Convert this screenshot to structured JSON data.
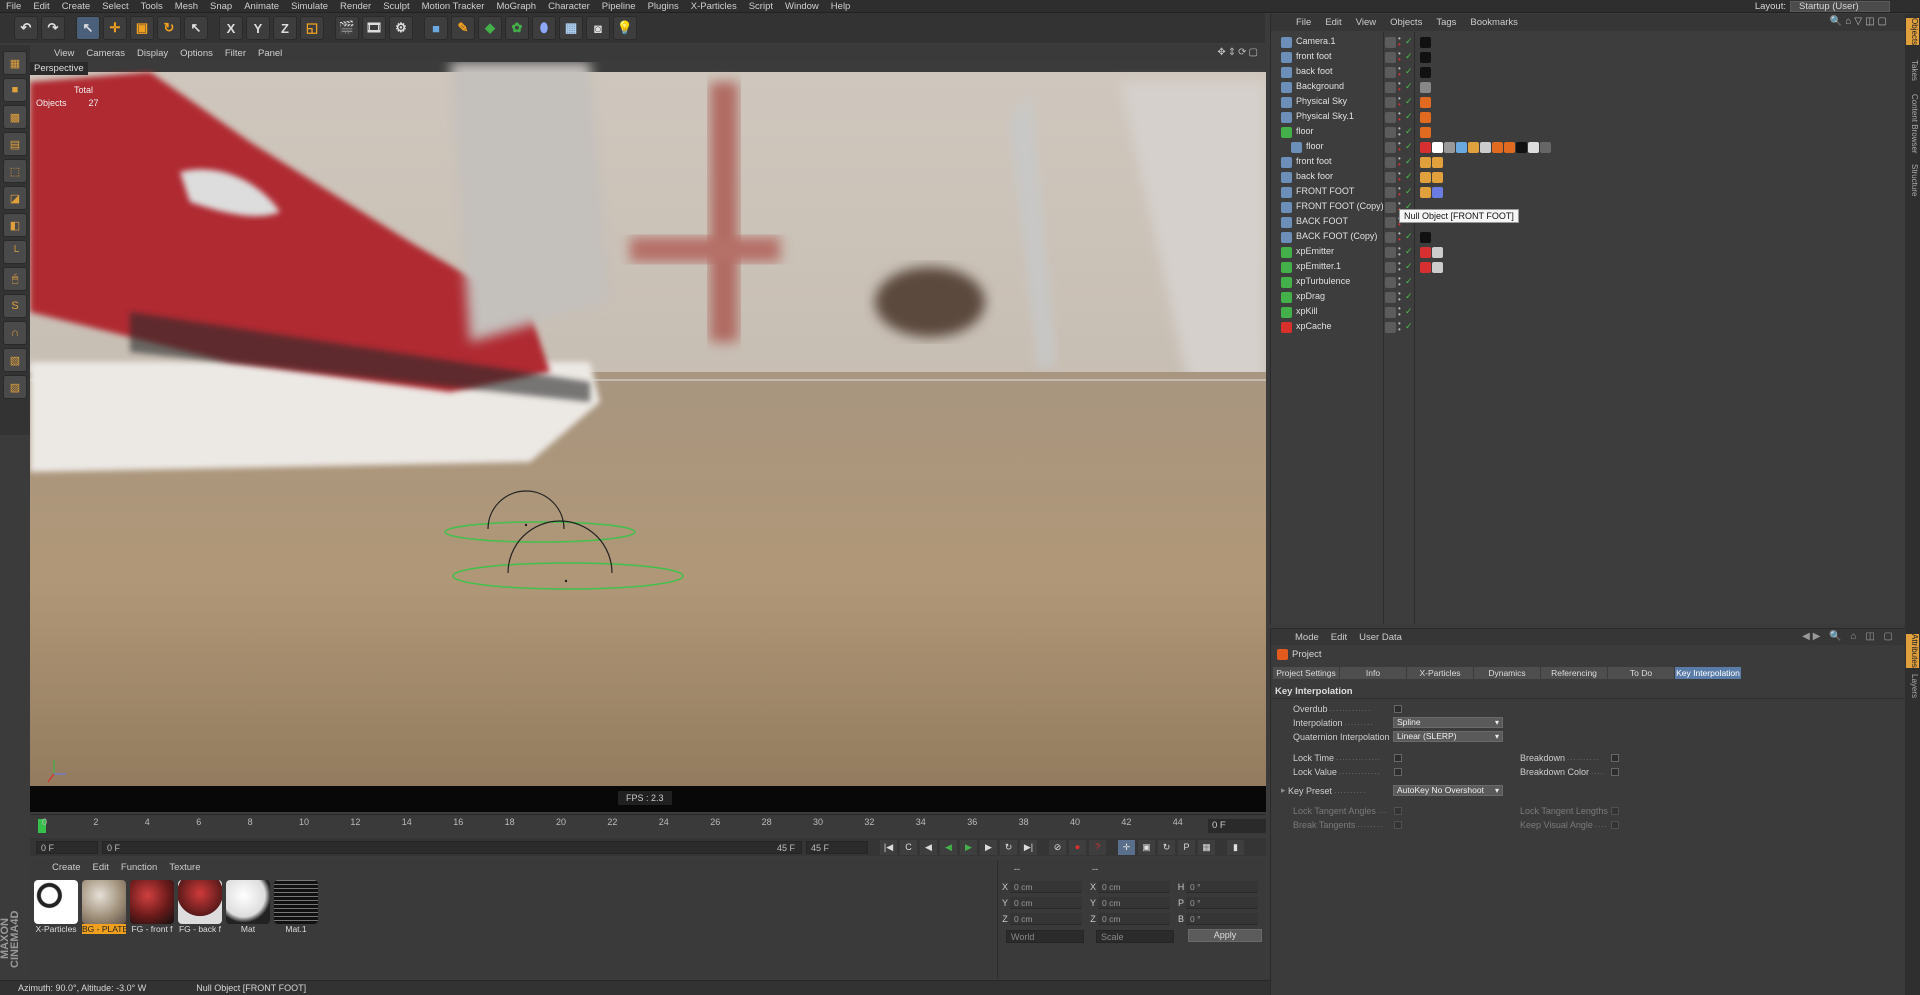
{
  "menubar": {
    "items": [
      "File",
      "Edit",
      "Create",
      "Select",
      "Tools",
      "Mesh",
      "Snap",
      "Animate",
      "Simulate",
      "Render",
      "Sculpt",
      "Motion Tracker",
      "MoGraph",
      "Character",
      "Pipeline",
      "Plugins",
      "X-Particles",
      "Script",
      "Window",
      "Help"
    ],
    "layout_label": "Layout:",
    "layout_value": "Startup (User)"
  },
  "toolbar": {
    "axis_x": "X",
    "axis_y": "Y",
    "axis_z": "Z"
  },
  "viewport": {
    "menu": [
      "View",
      "Cameras",
      "Display",
      "Options",
      "Filter",
      "Panel"
    ],
    "label": "Perspective",
    "hud_total": "Total",
    "hud_objects_label": "Objects",
    "hud_objects_value": "27",
    "fps": "FPS : 2.3"
  },
  "timeline": {
    "ticks": [
      "0",
      "2",
      "4",
      "6",
      "8",
      "10",
      "12",
      "14",
      "16",
      "18",
      "20",
      "22",
      "24",
      "26",
      "28",
      "30",
      "32",
      "34",
      "36",
      "38",
      "40",
      "42",
      "44"
    ],
    "current_frame": "0 F",
    "start_field": "0 F",
    "range_start": "0 F",
    "range_end": "45 F",
    "end_field": "45 F"
  },
  "materials": {
    "menu": [
      "Create",
      "Edit",
      "Function",
      "Texture"
    ],
    "items": [
      {
        "name": "X-Particles",
        "selected": false
      },
      {
        "name": "BG - PLATE",
        "selected": true
      },
      {
        "name": "FG - front f",
        "selected": false
      },
      {
        "name": "FG - back f",
        "selected": false
      },
      {
        "name": "Mat",
        "selected": false
      },
      {
        "name": "Mat.1",
        "selected": false
      }
    ]
  },
  "coords": {
    "header_mid": "--",
    "header_right": "--",
    "rows": [
      {
        "a": "X",
        "av": "0 cm",
        "b": "X",
        "bv": "0 cm",
        "c": "H",
        "cv": "0 °"
      },
      {
        "a": "Y",
        "av": "0 cm",
        "b": "Y",
        "bv": "0 cm",
        "c": "P",
        "cv": "0 °"
      },
      {
        "a": "Z",
        "av": "0 cm",
        "b": "Z",
        "bv": "0 cm",
        "c": "B",
        "cv": "0 °"
      }
    ],
    "world": "World",
    "scale": "Scale",
    "apply": "Apply"
  },
  "status": {
    "text": "Azimuth: 90.0°, Altitude: -3.0°  W",
    "selection": "Null Object [FRONT FOOT]"
  },
  "brand": "MAXON CINEMA4D",
  "objects": {
    "menu": [
      "File",
      "Edit",
      "View",
      "Objects",
      "Tags",
      "Bookmarks"
    ],
    "rows": [
      {
        "name": "Camera.1",
        "indent": 0,
        "icon": "camera-icon",
        "color": "#6b8fb8"
      },
      {
        "name": "front foot",
        "indent": 0,
        "icon": "mesh-icon",
        "color": "#6b8fb8"
      },
      {
        "name": "back foot",
        "indent": 0,
        "icon": "mesh-icon",
        "color": "#6b8fb8"
      },
      {
        "name": "Background",
        "indent": 0,
        "icon": "background-icon",
        "color": "#6b8fb8"
      },
      {
        "name": "Physical Sky",
        "indent": 0,
        "icon": "sky-icon",
        "color": "#6b8fb8"
      },
      {
        "name": "Physical Sky.1",
        "indent": 0,
        "icon": "sky-icon",
        "color": "#6b8fb8"
      },
      {
        "name": "floor",
        "indent": 0,
        "icon": "floor-icon",
        "color": "#43b04a"
      },
      {
        "name": "floor",
        "indent": 1,
        "icon": "mesh-icon",
        "color": "#6b8fb8"
      },
      {
        "name": "front foot",
        "indent": 0,
        "icon": "mesh-icon",
        "color": "#6b8fb8"
      },
      {
        "name": "back foor",
        "indent": 0,
        "icon": "mesh-icon",
        "color": "#6b8fb8"
      },
      {
        "name": "FRONT FOOT",
        "indent": 0,
        "icon": "null-icon",
        "color": "#6b8fb8"
      },
      {
        "name": "FRONT FOOT (Copy)",
        "indent": 0,
        "icon": "null-icon",
        "color": "#6b8fb8"
      },
      {
        "name": "BACK FOOT",
        "indent": 0,
        "icon": "null-icon",
        "color": "#6b8fb8"
      },
      {
        "name": "BACK FOOT (Copy)",
        "indent": 0,
        "icon": "null-icon",
        "color": "#6b8fb8"
      },
      {
        "name": "xpEmitter",
        "indent": 0,
        "icon": "emitter-icon",
        "color": "#43b04a"
      },
      {
        "name": "xpEmitter.1",
        "indent": 0,
        "icon": "emitter-icon",
        "color": "#43b04a"
      },
      {
        "name": "xpTurbulence",
        "indent": 0,
        "icon": "turbulence-icon",
        "color": "#43b04a"
      },
      {
        "name": "xpDrag",
        "indent": 0,
        "icon": "drag-icon",
        "color": "#43b04a"
      },
      {
        "name": "xpKill",
        "indent": 0,
        "icon": "kill-icon",
        "color": "#43b04a"
      },
      {
        "name": "xpCache",
        "indent": 0,
        "icon": "cache-icon",
        "color": "#d8302a"
      }
    ],
    "tooltip": "Null Object [FRONT FOOT]"
  },
  "right_tabs": [
    "Objects",
    "Takes",
    "Content Browser",
    "Structure",
    "Attributes",
    "Layers"
  ],
  "attributes": {
    "menu": [
      "Mode",
      "Edit",
      "User Data"
    ],
    "object": "Project",
    "tabs": [
      {
        "label": "Project Settings",
        "active": false
      },
      {
        "label": "Info",
        "active": false
      },
      {
        "label": "X-Particles",
        "active": false
      },
      {
        "label": "Dynamics",
        "active": false
      },
      {
        "label": "Referencing",
        "active": false
      },
      {
        "label": "To Do",
        "active": false
      },
      {
        "label": "Key Interpolation",
        "active": true
      }
    ],
    "section": "Key Interpolation",
    "overdub": "Overdub",
    "interpolation_label": "Interpolation",
    "interpolation_value": "Spline",
    "quat_label": "Quaternion Interpolation",
    "quat_value": "Linear (SLERP)",
    "lock_time": "Lock Time",
    "lock_value": "Lock Value",
    "breakdown": "Breakdown",
    "breakdown_color": "Breakdown Color",
    "key_preset_label": "Key Preset",
    "key_preset_value": "AutoKey No Overshoot",
    "lock_tangent_angles": "Lock Tangent Angles",
    "break_tangents": "Break Tangents",
    "lock_tangent_lengths": "Lock Tangent Lengths",
    "keep_visual_angle": "Keep Visual Angle"
  },
  "colors": {
    "accent": "#e0a03c",
    "selection_blue": "#5a7ca8",
    "emitter_green": "#43b04a",
    "shoe_red": "#b02a30"
  }
}
